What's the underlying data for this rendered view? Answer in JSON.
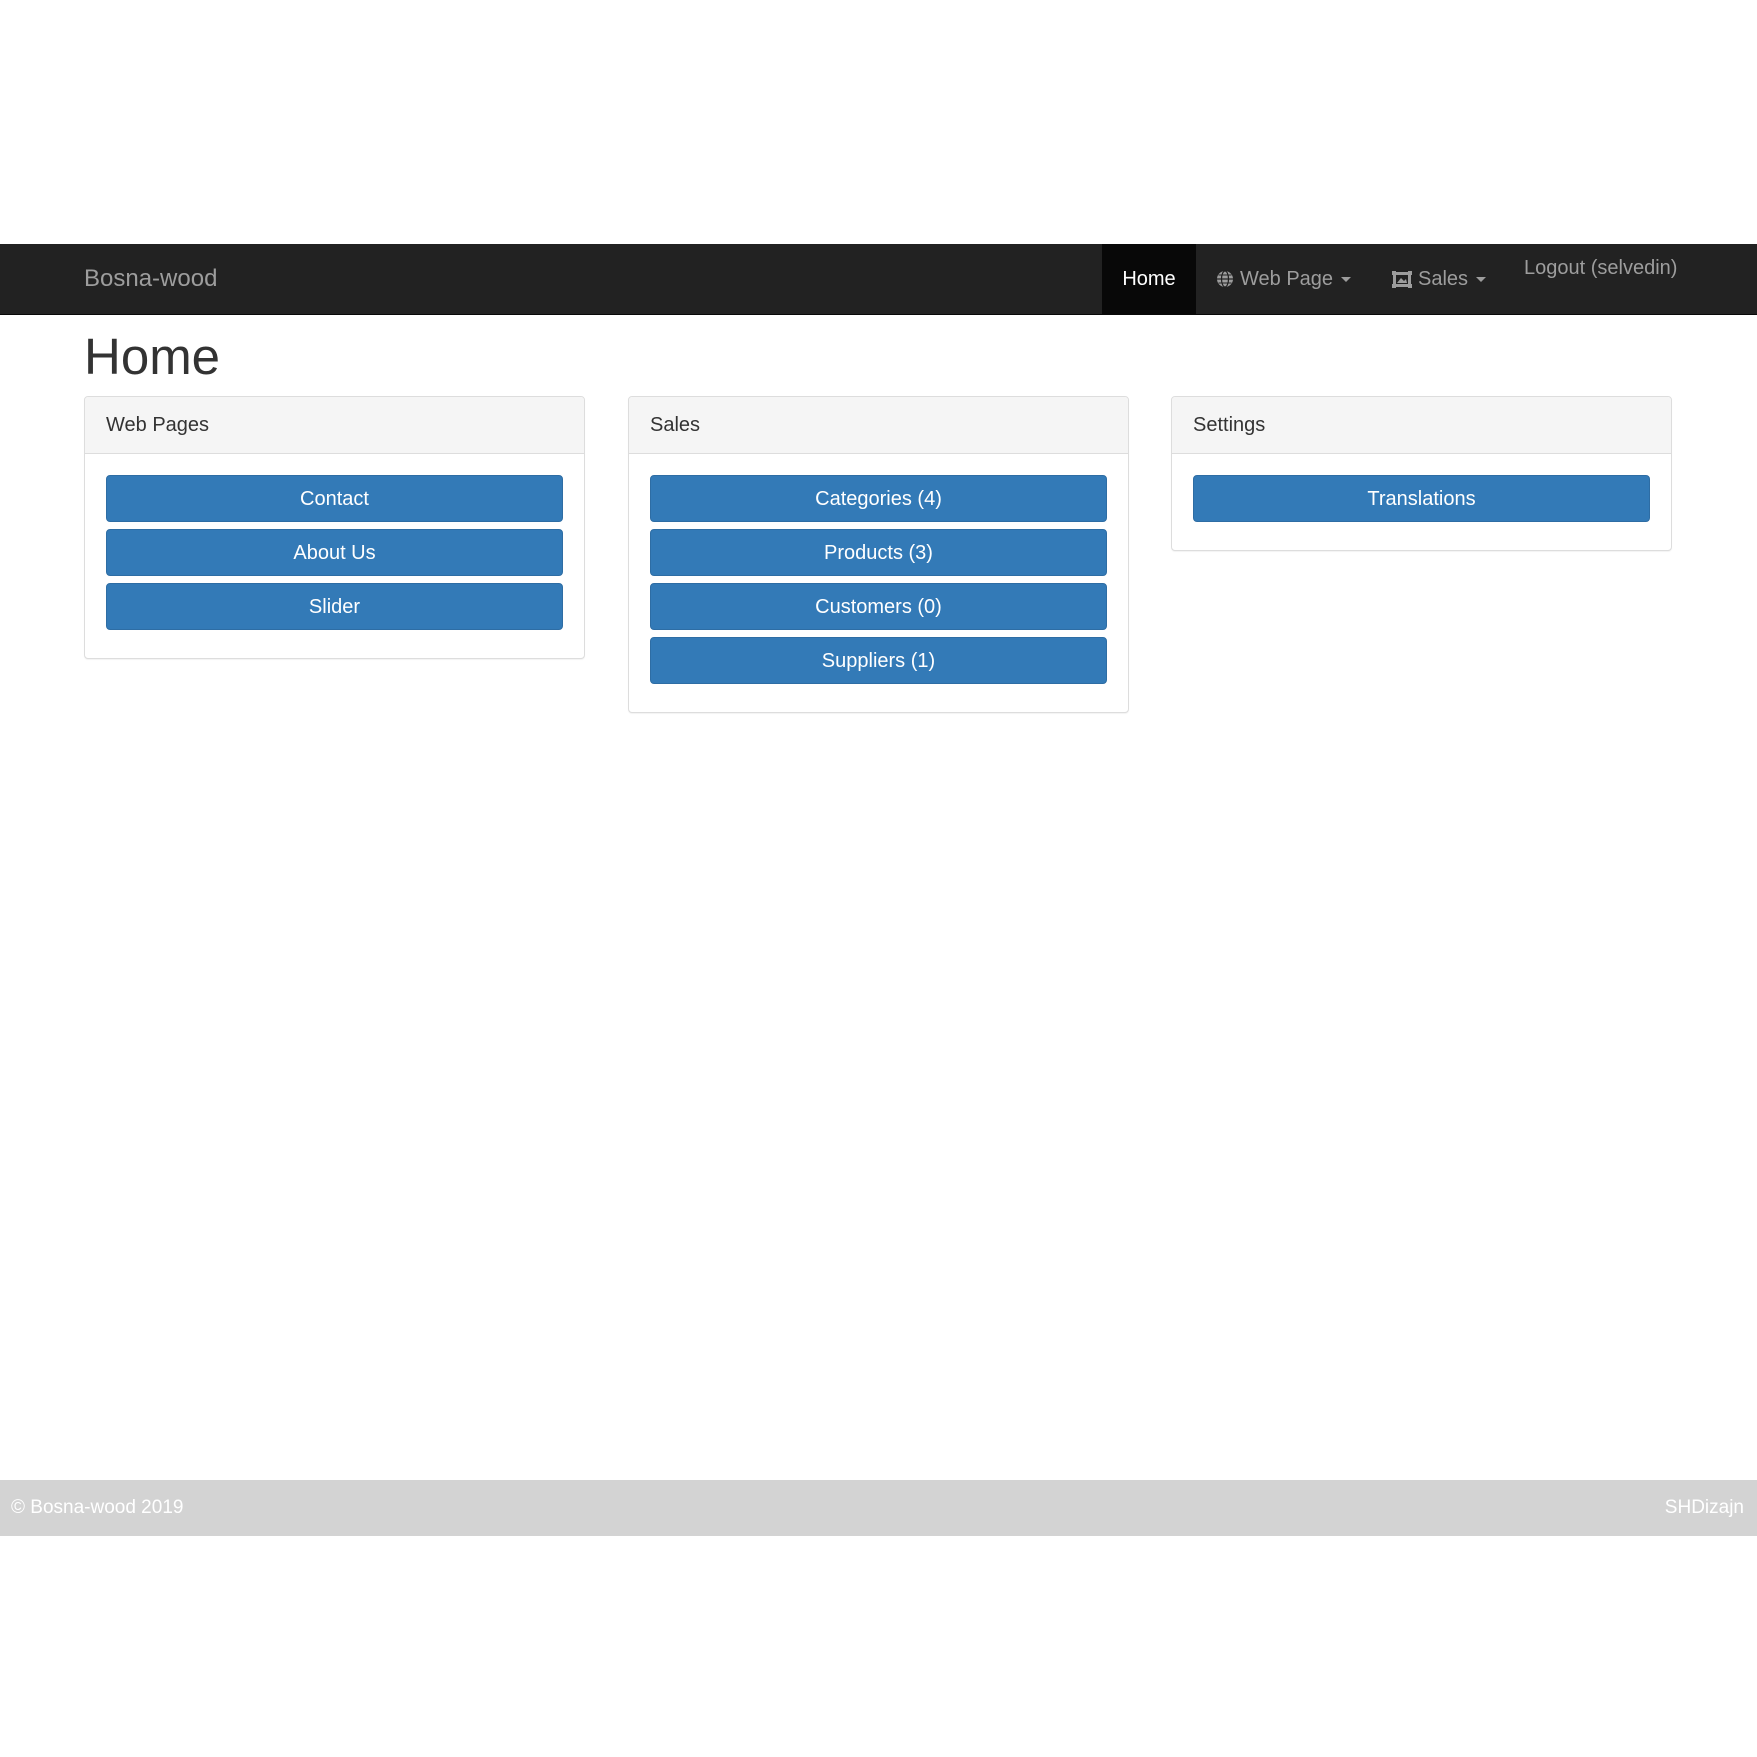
{
  "navbar": {
    "brand": "Bosna-wood",
    "items": [
      {
        "label": "Home",
        "active": true
      },
      {
        "label": "Web Page",
        "icon": "globe-icon",
        "dropdown": true
      },
      {
        "label": "Sales",
        "icon": "picture-icon",
        "dropdown": true
      }
    ],
    "logout": "Logout (selvedin)"
  },
  "page": {
    "title": "Home"
  },
  "panels": [
    {
      "heading": "Web Pages",
      "buttons": [
        "Contact",
        "About Us",
        "Slider"
      ]
    },
    {
      "heading": "Sales",
      "buttons": [
        "Categories (4)",
        "Products (3)",
        "Customers (0)",
        "Suppliers (1)"
      ]
    },
    {
      "heading": "Settings",
      "buttons": [
        "Translations"
      ]
    }
  ],
  "footer": {
    "copyright": "© Bosna-wood 2019",
    "credit": "SHDizajn"
  },
  "colors": {
    "navbar": "#222222",
    "active_nav": "#080808",
    "button": "#337ab7",
    "footer": "#d3d3d3"
  }
}
